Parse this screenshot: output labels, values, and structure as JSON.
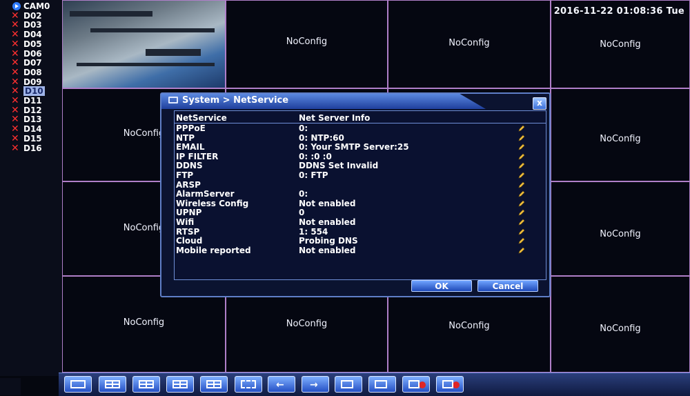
{
  "channels": [
    {
      "label": "CAM0",
      "type": "camera"
    },
    {
      "label": "D02",
      "type": "off"
    },
    {
      "label": "D03",
      "type": "off"
    },
    {
      "label": "D04",
      "type": "off"
    },
    {
      "label": "D05",
      "type": "off"
    },
    {
      "label": "D06",
      "type": "off"
    },
    {
      "label": "D07",
      "type": "off"
    },
    {
      "label": "D08",
      "type": "off"
    },
    {
      "label": "D09",
      "type": "off"
    },
    {
      "label": "D10",
      "type": "off",
      "selected": true
    },
    {
      "label": "D11",
      "type": "off"
    },
    {
      "label": "D12",
      "type": "off"
    },
    {
      "label": "D13",
      "type": "off"
    },
    {
      "label": "D14",
      "type": "off"
    },
    {
      "label": "D15",
      "type": "off"
    },
    {
      "label": "D16",
      "type": "off"
    }
  ],
  "datetime": "2016-11-22 01:08:36 Tue",
  "grid": {
    "noconfig_label": "NoConfig"
  },
  "dialog": {
    "title": "System > NetService",
    "close_label": "x",
    "header_service": "NetService",
    "header_info": "Net Server Info",
    "rows": [
      {
        "service": "PPPoE",
        "info": "0:"
      },
      {
        "service": "NTP",
        "info": "0: NTP:60"
      },
      {
        "service": "EMAIL",
        "info": "0: Your SMTP Server:25"
      },
      {
        "service": "IP FILTER",
        "info": "0: :0 :0"
      },
      {
        "service": "DDNS",
        "info": "DDNS Set Invalid"
      },
      {
        "service": "FTP",
        "info": "0: FTP"
      },
      {
        "service": "ARSP",
        "info": ""
      },
      {
        "service": "AlarmServer",
        "info": "0:"
      },
      {
        "service": "Wireless Config",
        "info": "Not enabled"
      },
      {
        "service": "UPNP",
        "info": "0"
      },
      {
        "service": "Wifi",
        "info": "Not enabled"
      },
      {
        "service": "RTSP",
        "info": "1: 554"
      },
      {
        "service": "Cloud",
        "info": "Probing DNS"
      },
      {
        "service": "Mobile reported",
        "info": "Not enabled"
      }
    ],
    "ok_label": "OK",
    "cancel_label": "Cancel"
  },
  "toolbar": {
    "buttons": [
      "single-view-icon",
      "quad-view-icon",
      "six-view-icon",
      "nine-view-icon",
      "sixteen-view-icon",
      "fullscreen-icon",
      "previous-page-icon",
      "next-page-icon",
      "playback-icon",
      "record-icon",
      "video-record-icon",
      "alarm-record-icon"
    ]
  },
  "colors": {
    "accent_blue": "#2e5fd0",
    "grid_line": "#b07fc9",
    "disabled_x": "#ff3030",
    "edit_pencil": "#f0c040"
  }
}
